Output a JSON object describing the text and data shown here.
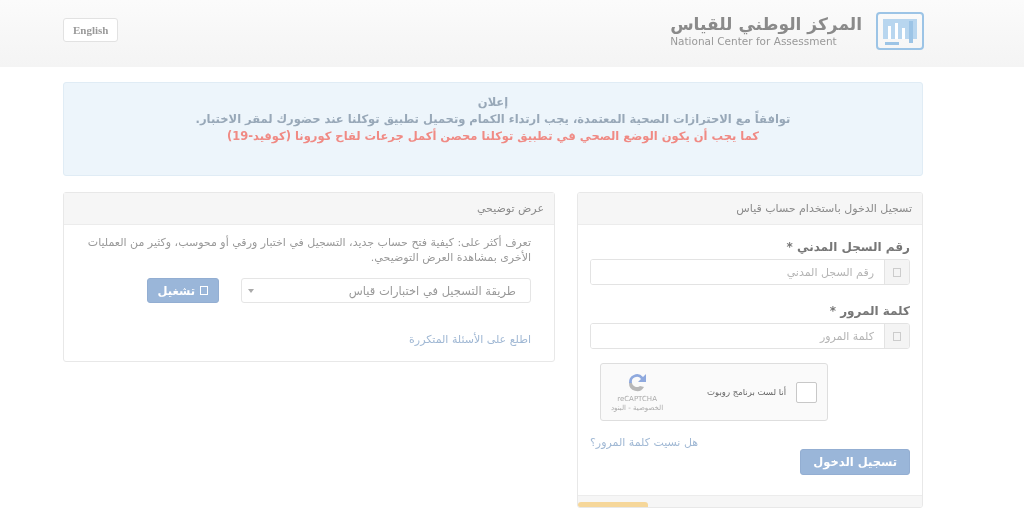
{
  "header": {
    "language_button": "English",
    "logo_title_ar": "المركز الوطني للقياس",
    "logo_title_en": "National Center for Assessment"
  },
  "announcement": {
    "title": "إعلان",
    "lines": [
      {
        "kind": "info",
        "text": "توافقاً مع الاحترازات الصحية المعتمدة، يجب ارتداء الكمام وتحميل تطبيق توكلنا عند حضورك لمقر الاختبار."
      },
      {
        "kind": "warning",
        "text": "كما يجب أن يكون الوضع الصحي في تطبيق توكلنا محصن أكمل جرعات لقاح كورونا (كوفيد-19)"
      }
    ]
  },
  "demo_panel": {
    "title": "عرض توضيحي",
    "description": "تعرف أكثر على: كيفية فتح حساب جديد، التسجيل في اختبار ورقي أو محوسب، وكثير من العمليات الأخرى بمشاهدة العرض التوضيحي.",
    "dropdown": {
      "value": "طريقة التسجيل في اختبارات قياس"
    },
    "play_button": "تشغيل",
    "faq_link": "اطلع على الأسئلة المتكررة"
  },
  "login_panel": {
    "title": "تسجيل الدخول باستخدام حساب قياس",
    "fields": [
      {
        "label": "رقم السجل المدني *",
        "placeholder": "رقم السجل المدني"
      },
      {
        "label": "كلمة المرور *",
        "placeholder": "كلمة المرور"
      }
    ],
    "captcha": {
      "label": "أنا لست برنامج روبوت",
      "checked": false,
      "brand": "reCAPTCHA",
      "links": "الخصوصية - البنود"
    },
    "forgot_link": "هل نسيت كلمة المرور؟",
    "submit_button": "تسجيل الدخول"
  }
}
